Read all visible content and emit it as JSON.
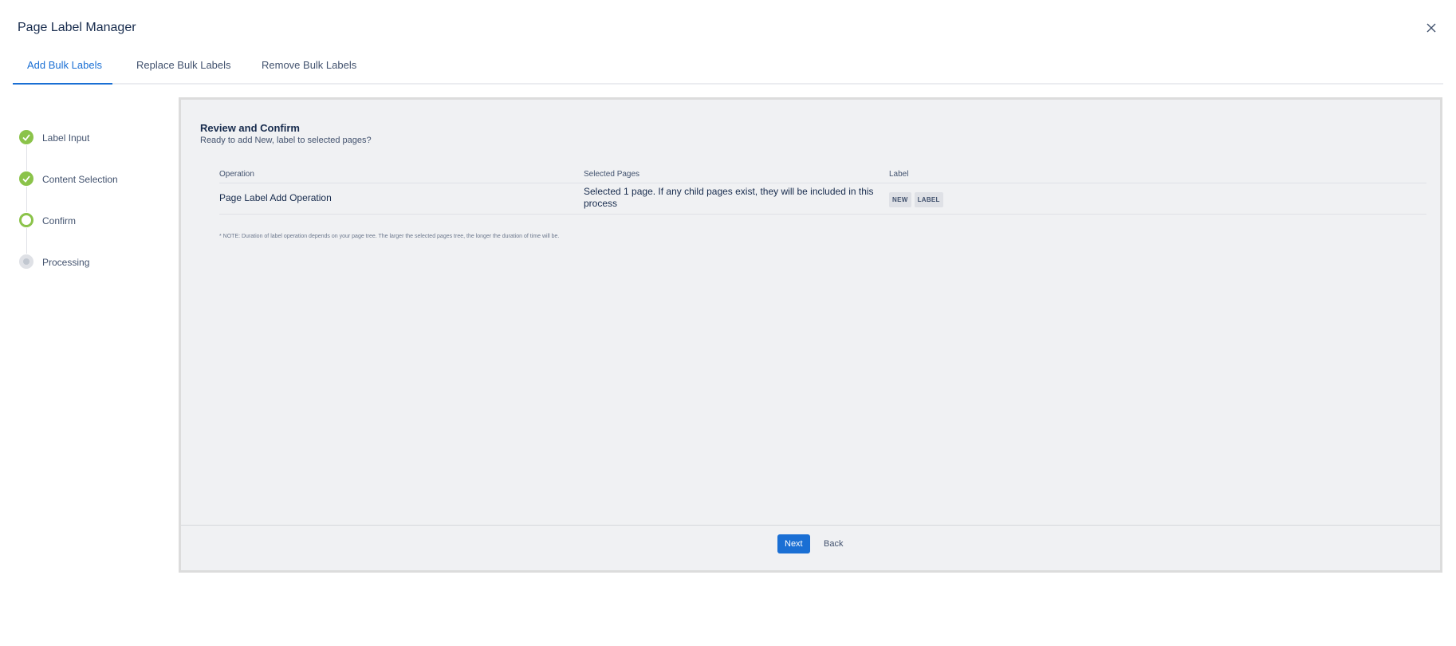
{
  "window": {
    "title": "Page Label Manager",
    "close_icon": "close-icon"
  },
  "tabs": [
    {
      "label": "Add Bulk Labels",
      "active": true
    },
    {
      "label": "Replace Bulk Labels",
      "active": false
    },
    {
      "label": "Remove Bulk Labels",
      "active": false
    }
  ],
  "steps": [
    {
      "label": "Label Input",
      "state": "done"
    },
    {
      "label": "Content Selection",
      "state": "done"
    },
    {
      "label": "Confirm",
      "state": "current"
    },
    {
      "label": "Processing",
      "state": "pending"
    }
  ],
  "review": {
    "title": "Review and Confirm",
    "subtitle": "Ready to add New, label to selected pages?",
    "columns": [
      "Operation",
      "Selected Pages",
      "Label"
    ],
    "row": {
      "operation": "Page Label Add Operation",
      "selected_pages": "Selected 1 page. If any child pages exist, they will be included in this process",
      "labels": [
        "NEW",
        "LABEL"
      ]
    },
    "note": "* NOTE: Duration of label operation depends on your page tree. The larger the selected pages tree, the longer the duration of time will be."
  },
  "footer": {
    "next_label": "Next",
    "back_label": "Back"
  },
  "colors": {
    "accent": "#1a6fd4",
    "step_done": "#8bc34a",
    "panel_bg": "#f0f1f3"
  }
}
